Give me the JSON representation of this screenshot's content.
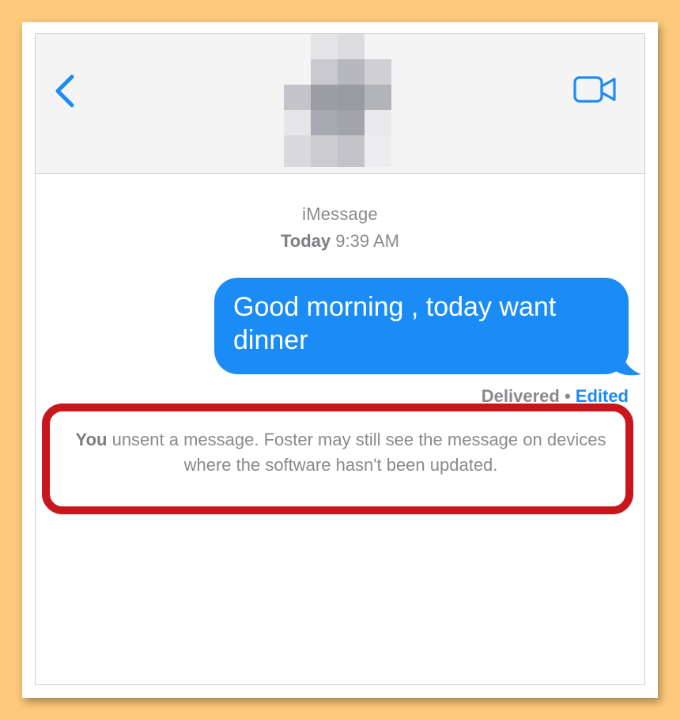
{
  "conversation": {
    "service": "iMessage",
    "time": {
      "day": "Today",
      "clock": "9:39 AM"
    },
    "contact_avatar": "blurred-contact-photo"
  },
  "navbar": {
    "back_icon": "chevron-left-icon",
    "video_icon": "video-camera-icon",
    "accent_color": "#1b8cf6"
  },
  "messages": [
    {
      "text": "Good morning , today want dinner",
      "status": "Delivered",
      "separator": "•",
      "edited_label": "Edited"
    }
  ],
  "unsent_notice": {
    "subject": "You",
    "text": "unsent a message. Foster may still see the message on devices where the software hasn't been updated."
  },
  "annotation": {
    "highlight_color": "#c9151c"
  }
}
